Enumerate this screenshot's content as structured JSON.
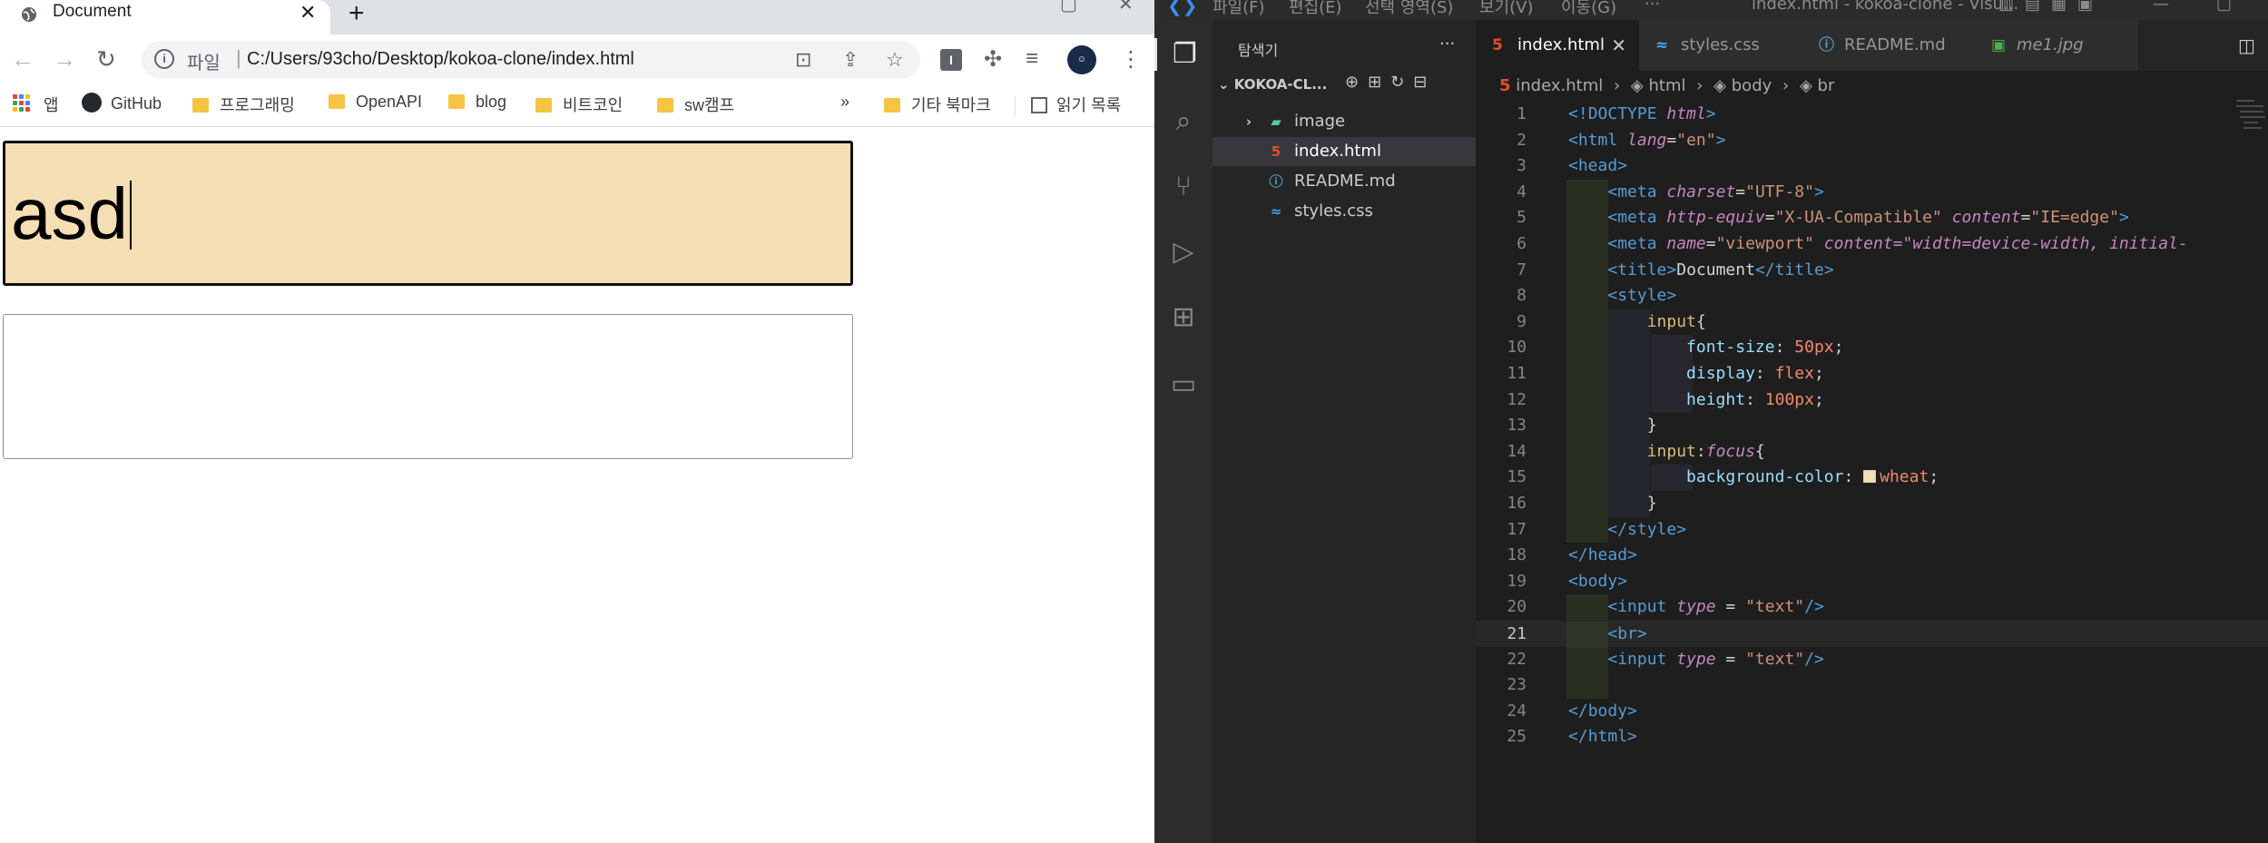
{
  "chrome": {
    "tab": {
      "title": "Document",
      "close": "✕"
    },
    "new_tab": "+",
    "window_controls": [
      "ˇ",
      "▢",
      "✕"
    ],
    "nav": {
      "back": "←",
      "forward": "→",
      "reload": "↻"
    },
    "omnibox": {
      "scheme": "파일",
      "separator": "|",
      "url": "C:/Users/93cho/Desktop/kokoa-clone/index.html"
    },
    "omnibox_icons": [
      "translate-icon",
      "share-icon",
      "star-icon"
    ],
    "profile_label": "☺",
    "extension_i": "I",
    "bookmarks": [
      {
        "label": "앱",
        "type": "apps"
      },
      {
        "label": "GitHub",
        "type": "github"
      },
      {
        "label": "프로그래밍",
        "type": "folder"
      },
      {
        "label": "OpenAPI",
        "type": "folder"
      },
      {
        "label": "blog",
        "type": "folder"
      },
      {
        "label": "비트코인",
        "type": "folder"
      },
      {
        "label": "sw캠프",
        "type": "folder"
      },
      {
        "label": "»",
        "type": "overflow"
      },
      {
        "label": "기타 북마크",
        "type": "folder"
      },
      {
        "label": "읽기 목록",
        "type": "reading-list"
      }
    ],
    "page": {
      "input1_value": "asd",
      "input2_value": ""
    }
  },
  "vscode": {
    "menu": [
      "파일(F)",
      "편집(E)",
      "선택 영역(S)",
      "보기(V)",
      "이동(G)",
      "···"
    ],
    "window_title": "index.html - kokoa-clone - Visu...",
    "sidebar": {
      "title": "탐색기",
      "more": "···",
      "root": "KOKOA-CL...",
      "items": [
        {
          "label": "image",
          "icon": "folder-icon",
          "glyph": "›"
        },
        {
          "label": "index.html",
          "icon": "html-file-icon",
          "glyph": "5"
        },
        {
          "label": "README.md",
          "icon": "info-file-icon",
          "glyph": "ⓘ"
        },
        {
          "label": "styles.css",
          "icon": "css-file-icon",
          "glyph": "≈"
        }
      ]
    },
    "tabs": [
      {
        "label": "index.html",
        "glyph": "5",
        "close": "✕"
      },
      {
        "label": "styles.css",
        "glyph": "≈"
      },
      {
        "label": "README.md",
        "glyph": "ⓘ"
      },
      {
        "label": "me1.jpg",
        "glyph": "▣"
      }
    ],
    "breadcrumb": [
      "index.html",
      "html",
      "body",
      "br"
    ],
    "breadcrumb_sep": "›",
    "code_lines": [
      "<!DOCTYPE html>",
      "<html lang=\"en\">",
      "<head>",
      "    <meta charset=\"UTF-8\">",
      "    <meta http-equiv=\"X-UA-Compatible\" content=\"IE=edge\">",
      "    <meta name=\"viewport\" content=\"width=device-width, initial-",
      "    <title>Document</title>",
      "    <style>",
      "        input{",
      "            font-size: 50px;",
      "            display: flex;",
      "            height: 100px;",
      "        }",
      "        input:focus{",
      "            background-color: wheat;",
      "        }",
      "    </style>",
      "</head>",
      "<body>",
      "    <input type = \"text\"/>",
      "    <br>",
      "    <input type = \"text\"/>",
      "",
      "</body>",
      "</html>"
    ],
    "current_line": 21,
    "colors": {
      "tag": "#569cd6",
      "attr": "#c586c0",
      "string": "#ce9178",
      "text": "#d4d4d4",
      "selector": "#d7ba7d",
      "property": "#9cdcfe",
      "number": "#f48771",
      "wheat": "#f5deb3"
    }
  }
}
